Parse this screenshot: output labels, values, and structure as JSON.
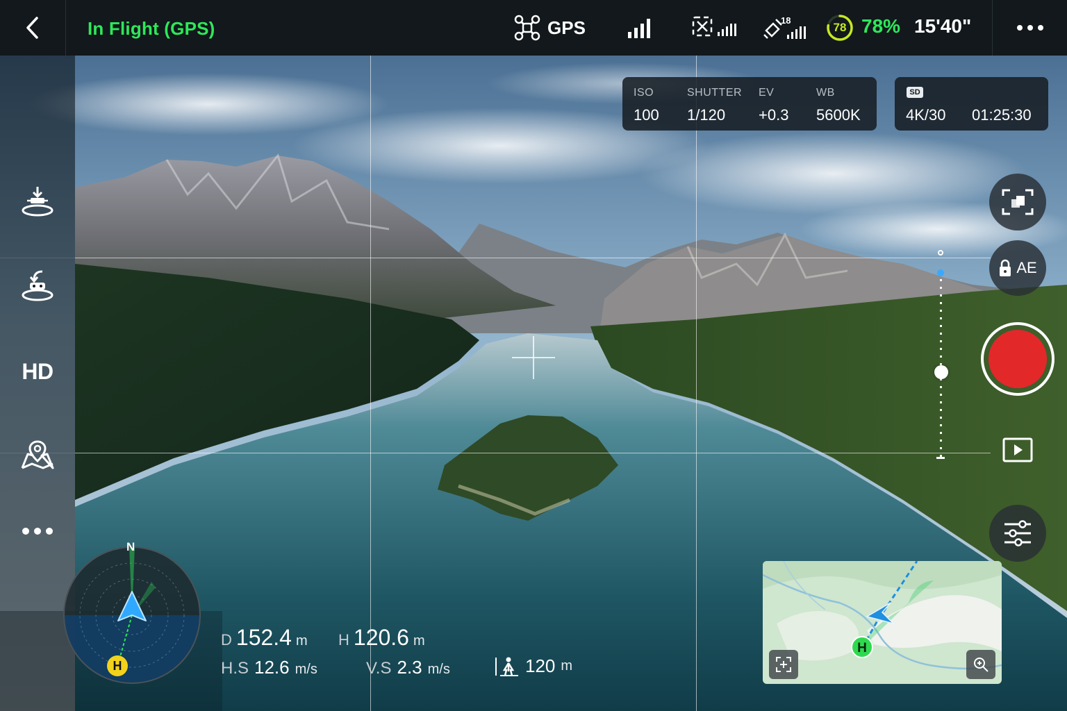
{
  "status_bar": {
    "flight_status": "In Flight (GPS)",
    "gps_label": "GPS",
    "satellite_count": "18",
    "battery_ring_value": "78",
    "battery_percent": "78%",
    "flight_time": "15'40\"",
    "accent_color": "#2ee85a"
  },
  "left_rail": {
    "items": [
      {
        "name": "auto-takeoff-landing",
        "icon": "drone-landing-icon"
      },
      {
        "name": "return-to-home",
        "icon": "return-home-icon"
      },
      {
        "name": "video-quality",
        "label": "HD"
      },
      {
        "name": "map",
        "icon": "map-pin-icon"
      },
      {
        "name": "more",
        "icon": "more-horizontal-icon"
      }
    ]
  },
  "camera_params": {
    "iso_label": "ISO",
    "iso_value": "100",
    "shutter_label": "SHUTTER",
    "shutter_value": "1/120",
    "ev_label": "EV",
    "ev_value": "+0.3",
    "wb_label": "WB",
    "wb_value": "5600K"
  },
  "storage": {
    "badge": "SD",
    "resolution": "4K/30",
    "remaining_time": "01:25:30"
  },
  "controls": {
    "ae_label": "AE",
    "record_color": "#e3282a",
    "gimbal_level": 0.52
  },
  "compass": {
    "north_label": "N",
    "home_label": "H"
  },
  "telemetry": {
    "distance_label": "D",
    "distance_value": "152.4",
    "distance_unit": "m",
    "height_label": "H",
    "height_value": "120.6",
    "height_unit": "m",
    "hspeed_label": "H.S",
    "hspeed_value": "12.6",
    "hspeed_unit": "m/s",
    "vspeed_label": "V.S",
    "vspeed_value": "2.3",
    "vspeed_unit": "m/s",
    "altitude_limit_value": "120",
    "altitude_limit_unit": "m"
  },
  "minimap": {
    "home_label": "H"
  }
}
